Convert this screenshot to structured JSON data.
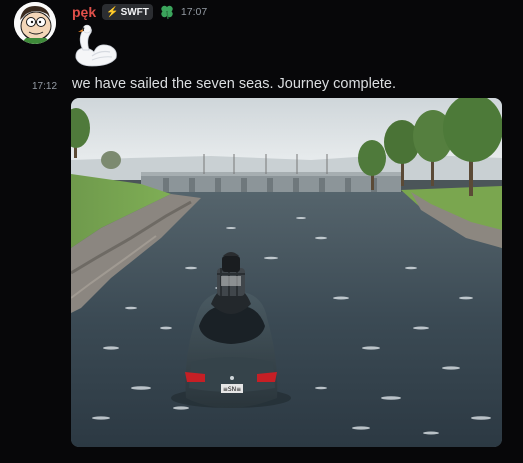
{
  "message": {
    "author": {
      "username": "pęk",
      "color": "#e0504a",
      "avatar_icon": "cartoon-character-avatar",
      "tag": {
        "icon": "lightning-bolt-icon",
        "label": "SWFT"
      },
      "clan_icon": "four-leaf-clover-icon"
    },
    "first_timestamp": "17:07",
    "first_content_icon": "swan-emoji",
    "second_timestamp": "17:12",
    "second_text": "we have sailed the seven seas. Journey complete.",
    "attachment": {
      "type": "image",
      "icon": "game-screenshot-car-on-river",
      "license_plate": "≡SN≡"
    }
  },
  "colors": {
    "background": "#070709",
    "text": "#dbdee1",
    "muted": "#949ba4",
    "tag_bg": "#2b2d31"
  }
}
